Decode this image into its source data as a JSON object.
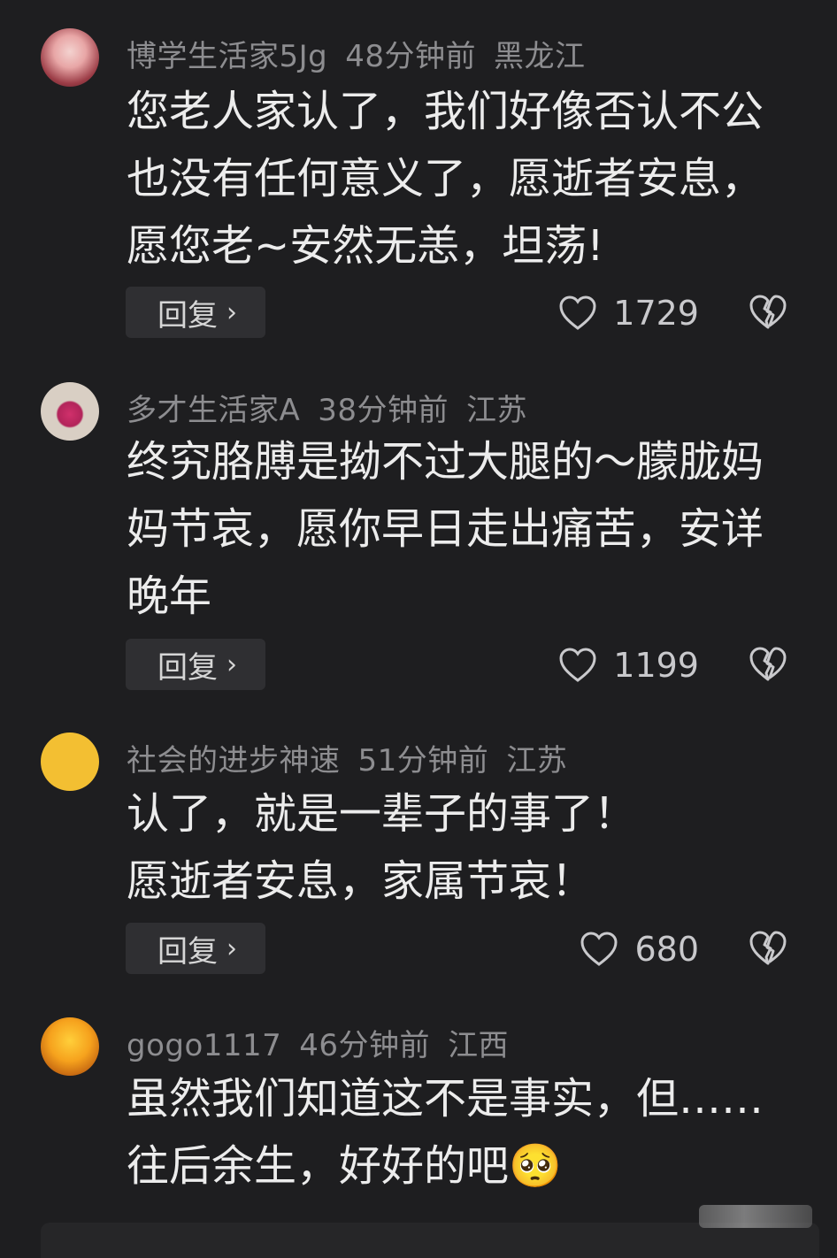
{
  "comments": [
    {
      "username": "博学生活家5Jg",
      "time": "48分钟前",
      "location": "黑龙江",
      "lines": [
        "您老人家认了，我们好像否认不公",
        "也没有任何意义了，愿逝者安息，",
        "愿您老~安然无恙，坦荡!"
      ],
      "reply_label": "回复",
      "likes": "1729"
    },
    {
      "username": "多才生活家A",
      "time": "38分钟前",
      "location": "江苏",
      "lines": [
        "终究胳膊是拗不过大腿的～朦胧妈",
        "妈节哀，愿你早日走出痛苦，安详",
        "晚年"
      ],
      "reply_label": "回复",
      "likes": "1199"
    },
    {
      "username": "社会的进步神速",
      "time": "51分钟前",
      "location": "江苏",
      "lines": [
        "认了，就是一辈子的事了！",
        "愿逝者安息，家属节哀！"
      ],
      "reply_label": "回复",
      "likes": "680"
    },
    {
      "username": "gogo1117",
      "time": "46分钟前",
      "location": "江西",
      "lines": [
        "虽然我们知道这不是事实，但……",
        "往后余生，好好的吧"
      ],
      "emoji": "🥺"
    }
  ],
  "icons": {
    "like": "heart-outline-icon",
    "dislike": "broken-heart-icon",
    "reply_chevron": "chevron-right-icon"
  },
  "colors": {
    "background": "#1e1e20",
    "text": "#ececec",
    "meta": "#8d8d90",
    "reply_button": "#2f2f32"
  }
}
